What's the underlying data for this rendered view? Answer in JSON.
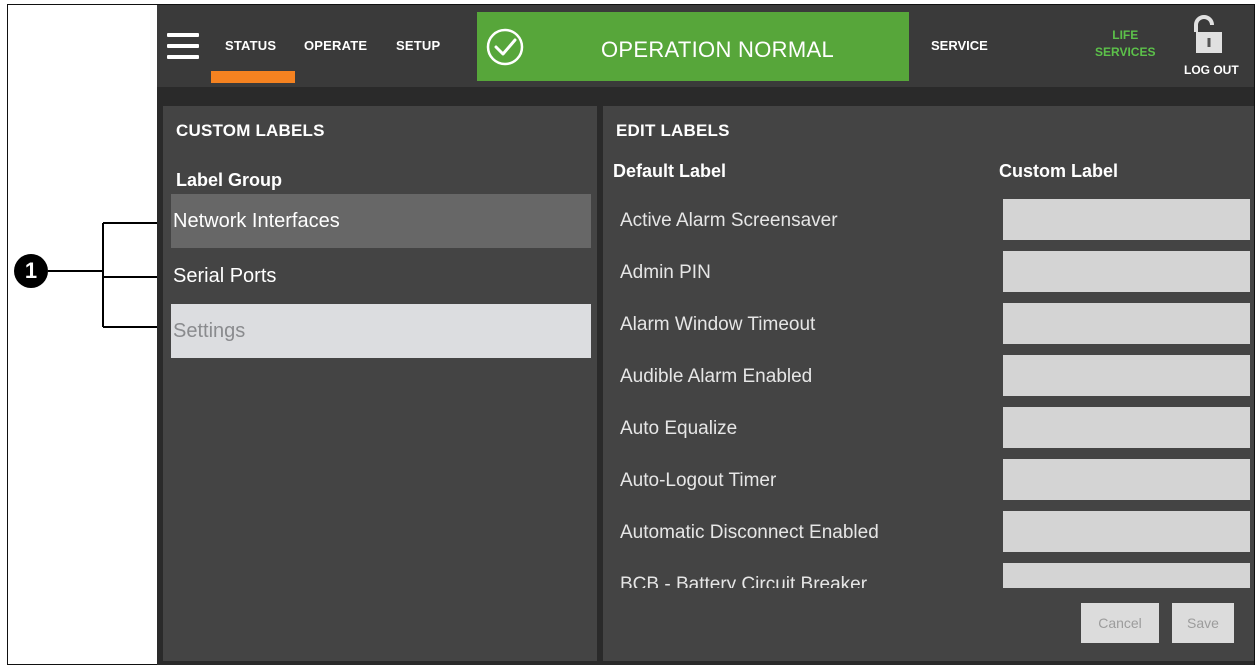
{
  "topbar": {
    "tabs": {
      "status": "STATUS",
      "operate": "OPERATE",
      "setup": "SETUP"
    },
    "active_tab": "STATUS",
    "status_text": "OPERATION NORMAL",
    "service": "SERVICE",
    "life_services_line1": "LIFE",
    "life_services_line2": "SERVICES",
    "logout": "LOG OUT"
  },
  "left_panel": {
    "title": "CUSTOM LABELS",
    "group_heading": "Label Group",
    "groups": [
      "Network Interfaces",
      "Serial Ports",
      "Settings"
    ]
  },
  "right_panel": {
    "title": "EDIT LABELS",
    "col_default": "Default Label",
    "col_custom": "Custom Label",
    "rows": [
      {
        "default": "Active Alarm Screensaver",
        "custom": ""
      },
      {
        "default": "Admin PIN",
        "custom": ""
      },
      {
        "default": "Alarm Window Timeout",
        "custom": ""
      },
      {
        "default": "Audible Alarm Enabled",
        "custom": ""
      },
      {
        "default": "Auto Equalize",
        "custom": ""
      },
      {
        "default": "Auto-Logout Timer",
        "custom": ""
      },
      {
        "default": "Automatic Disconnect Enabled",
        "custom": ""
      },
      {
        "default": "BCB - Battery Circuit Breaker",
        "custom": ""
      }
    ],
    "cancel": "Cancel",
    "save": "Save"
  },
  "annotation": {
    "number": "1"
  },
  "colors": {
    "accent_orange": "#f58220",
    "status_green": "#57a63a",
    "life_services_green": "#5cc14a",
    "panel_bg": "#444444",
    "selected_bg": "#dcdde0"
  },
  "icons": [
    "menu-icon",
    "check-circle-icon",
    "unlocked-padlock-icon"
  ]
}
